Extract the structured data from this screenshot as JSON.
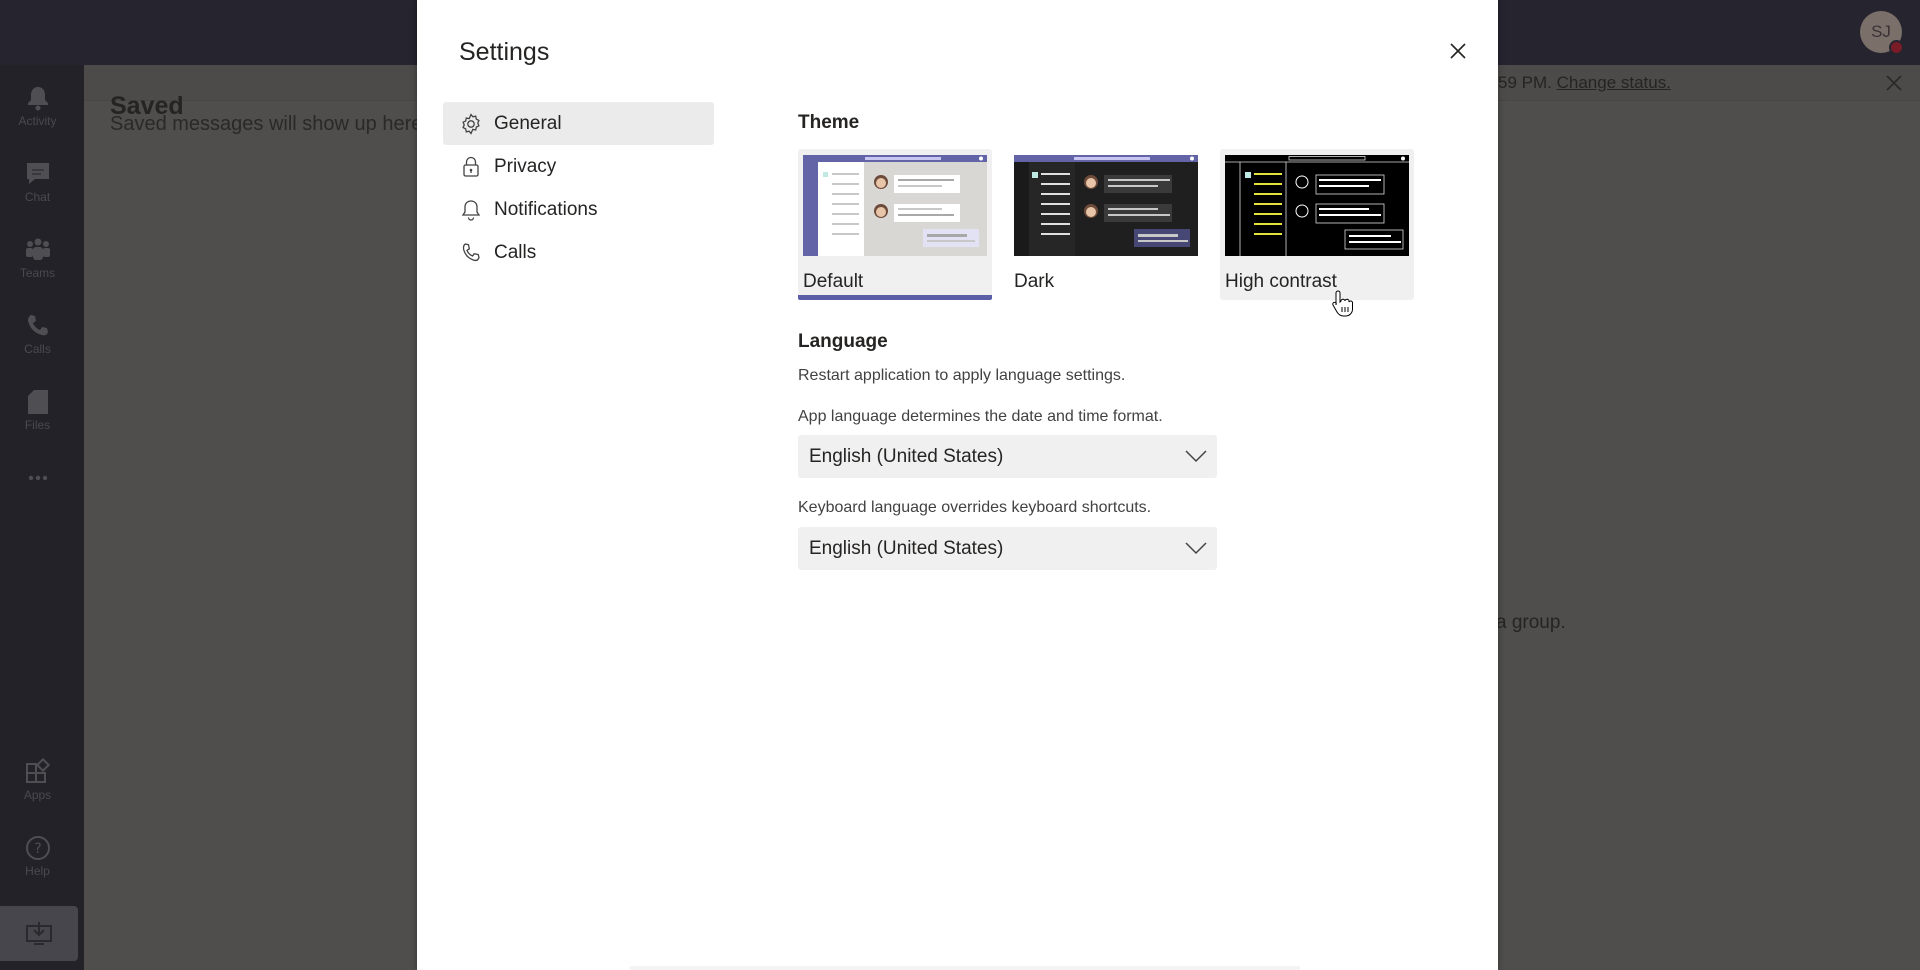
{
  "app": {
    "user_initials": "SJ",
    "presence_color": "#7a1c26",
    "rail": [
      {
        "label": "Activity",
        "icon": "bell-icon"
      },
      {
        "label": "Chat",
        "icon": "chat-icon"
      },
      {
        "label": "Teams",
        "icon": "teams-icon"
      },
      {
        "label": "Calls",
        "icon": "phone-icon"
      },
      {
        "label": "Files",
        "icon": "file-icon"
      },
      {
        "label": "",
        "icon": "more-icon"
      },
      {
        "label": "Apps",
        "icon": "apps-icon"
      },
      {
        "label": "Help",
        "icon": "help-icon"
      },
      {
        "label": "",
        "icon": "download-icon"
      }
    ],
    "saved": {
      "title": "Saved",
      "subtitle": "Saved messages will show up here"
    },
    "banner": {
      "text": "59 PM.",
      "link": "Change status."
    },
    "background_text": "a group."
  },
  "settings": {
    "title": "Settings",
    "nav": [
      {
        "label": "General",
        "icon": "gear-icon",
        "active": true
      },
      {
        "label": "Privacy",
        "icon": "lock-icon",
        "active": false
      },
      {
        "label": "Notifications",
        "icon": "bell-icon",
        "active": false
      },
      {
        "label": "Calls",
        "icon": "phone-icon",
        "active": false
      }
    ],
    "theme": {
      "heading": "Theme",
      "options": [
        {
          "label": "Default",
          "selected": true
        },
        {
          "label": "Dark",
          "selected": false
        },
        {
          "label": "High contrast",
          "selected": false
        }
      ],
      "accent_color": "#5b5fa8"
    },
    "language": {
      "heading": "Language",
      "restart_note": "Restart application to apply language settings.",
      "app_language_hint": "App language determines the date and time format.",
      "app_language_value": "English (United States)",
      "keyboard_language_hint": "Keyboard language overrides keyboard shortcuts.",
      "keyboard_language_value": "English (United States)"
    }
  }
}
